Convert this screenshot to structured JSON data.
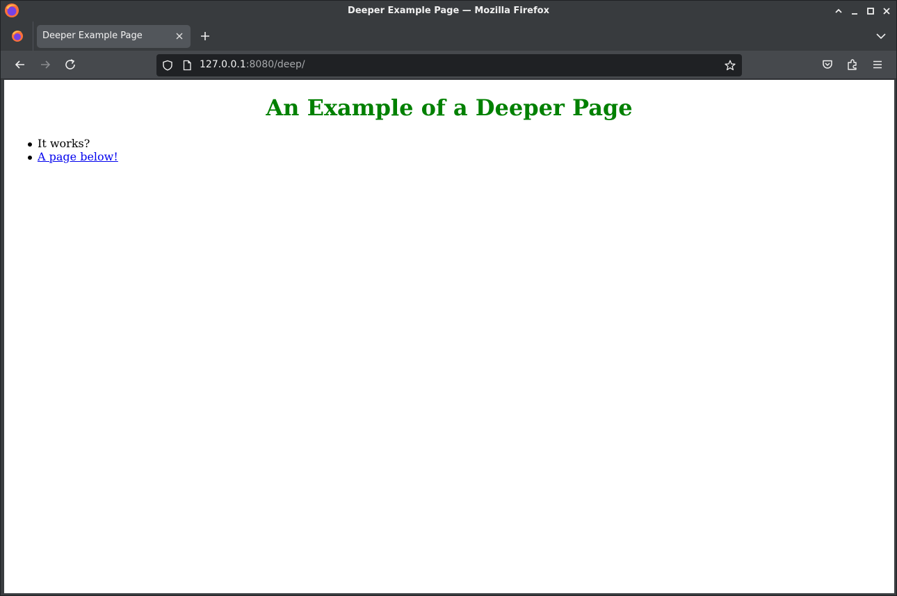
{
  "window": {
    "title": "Deeper Example Page — Mozilla Firefox"
  },
  "tabs": [
    {
      "title": "Deeper Example Page",
      "active": true
    }
  ],
  "urlbar": {
    "host": "127.0.0.1",
    "rest": ":8080/deep/"
  },
  "icons": {
    "app": "firefox-icon",
    "minimize": "chevron-up-icon",
    "maximize": "minimize-icon",
    "restore": "maximize-icon",
    "close": "close-icon",
    "back": "back-arrow-icon",
    "forward": "forward-arrow-icon",
    "reload": "reload-icon",
    "shield": "shield-icon",
    "page": "page-icon",
    "bookmark": "star-icon",
    "pocket": "pocket-icon",
    "extensions": "puzzle-icon",
    "menu": "hamburger-menu-icon",
    "new_tab": "plus-icon",
    "tab_list": "chevron-down-icon"
  },
  "page": {
    "heading": "An Example of a Deeper Page",
    "items": [
      {
        "text": "It works?",
        "link": false
      },
      {
        "text": "A page below!",
        "link": true
      }
    ],
    "heading_color": "#008000",
    "link_color": "#0000ee"
  }
}
